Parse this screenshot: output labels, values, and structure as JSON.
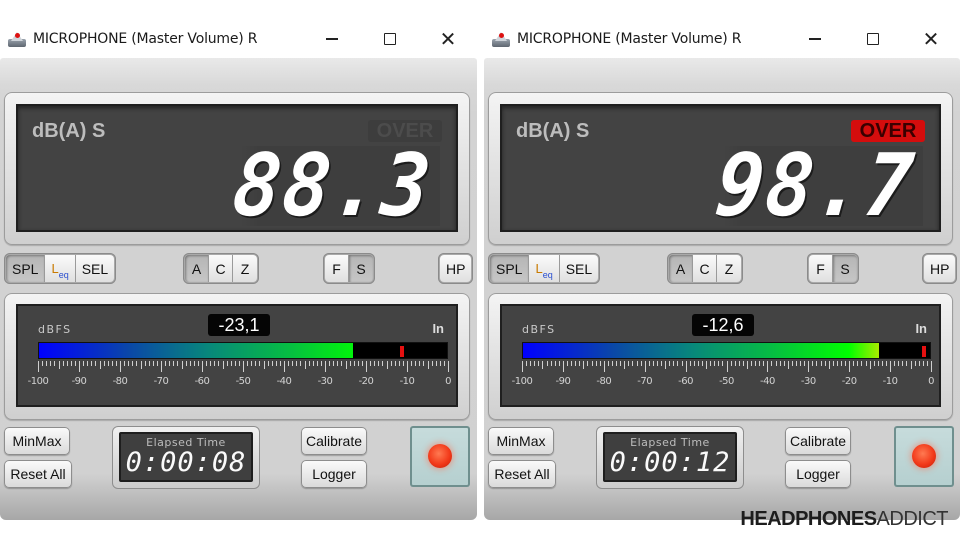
{
  "windows": [
    {
      "title": "MICROPHONE (Master Volume) R",
      "display": {
        "unit_label": "dB(A) S",
        "over_label": "OVER",
        "over_active": false,
        "level_value": "88.3"
      },
      "mode_buttons": [
        {
          "label": "SPL",
          "pressed": true
        },
        {
          "label": "Leq",
          "pressed": false
        },
        {
          "label": "SEL",
          "pressed": false
        }
      ],
      "weighting_buttons": [
        {
          "label": "A",
          "pressed": true
        },
        {
          "label": "C",
          "pressed": false
        },
        {
          "label": "Z",
          "pressed": false
        }
      ],
      "response_buttons": [
        {
          "label": "F",
          "pressed": false
        },
        {
          "label": "S",
          "pressed": true
        }
      ],
      "hp_button": {
        "label": "HP",
        "pressed": false
      },
      "meter": {
        "scale_label": "dBFS",
        "channel_label": "In",
        "readout": "-23,1",
        "level_dbfs": -23.1,
        "peak_dbfs": -11,
        "min": -100,
        "max": 0,
        "tick_labels": [
          "-100",
          "-90",
          "-80",
          "-70",
          "-60",
          "-50",
          "-40",
          "-30",
          "-20",
          "-10",
          "0"
        ]
      },
      "buttons": {
        "minmax": "MinMax",
        "reset_all": "Reset All",
        "calibrate": "Calibrate",
        "logger": "Logger"
      },
      "timer": {
        "label": "Elapsed Time",
        "value": "0:00:08"
      }
    },
    {
      "title": "MICROPHONE (Master Volume) R",
      "display": {
        "unit_label": "dB(A) S",
        "over_label": "OVER",
        "over_active": true,
        "level_value": "98.7"
      },
      "mode_buttons": [
        {
          "label": "SPL",
          "pressed": true
        },
        {
          "label": "Leq",
          "pressed": false
        },
        {
          "label": "SEL",
          "pressed": false
        }
      ],
      "weighting_buttons": [
        {
          "label": "A",
          "pressed": true
        },
        {
          "label": "C",
          "pressed": false
        },
        {
          "label": "Z",
          "pressed": false
        }
      ],
      "response_buttons": [
        {
          "label": "F",
          "pressed": false
        },
        {
          "label": "S",
          "pressed": true
        }
      ],
      "hp_button": {
        "label": "HP",
        "pressed": false
      },
      "meter": {
        "scale_label": "dBFS",
        "channel_label": "In",
        "readout": "-12,6",
        "level_dbfs": -12.6,
        "peak_dbfs": -1.5,
        "min": -100,
        "max": 0,
        "tick_labels": [
          "-100",
          "-90",
          "-80",
          "-70",
          "-60",
          "-50",
          "-40",
          "-30",
          "-20",
          "-10",
          "0"
        ]
      },
      "buttons": {
        "minmax": "MinMax",
        "reset_all": "Reset All",
        "calibrate": "Calibrate",
        "logger": "Logger"
      },
      "timer": {
        "label": "Elapsed Time",
        "value": "0:00:12"
      }
    }
  ],
  "window_controls": {
    "minimize": "minimize",
    "maximize": "maximize",
    "close": "close"
  },
  "watermark": {
    "bold": "HEADPHONES",
    "light": "ADDICT"
  }
}
